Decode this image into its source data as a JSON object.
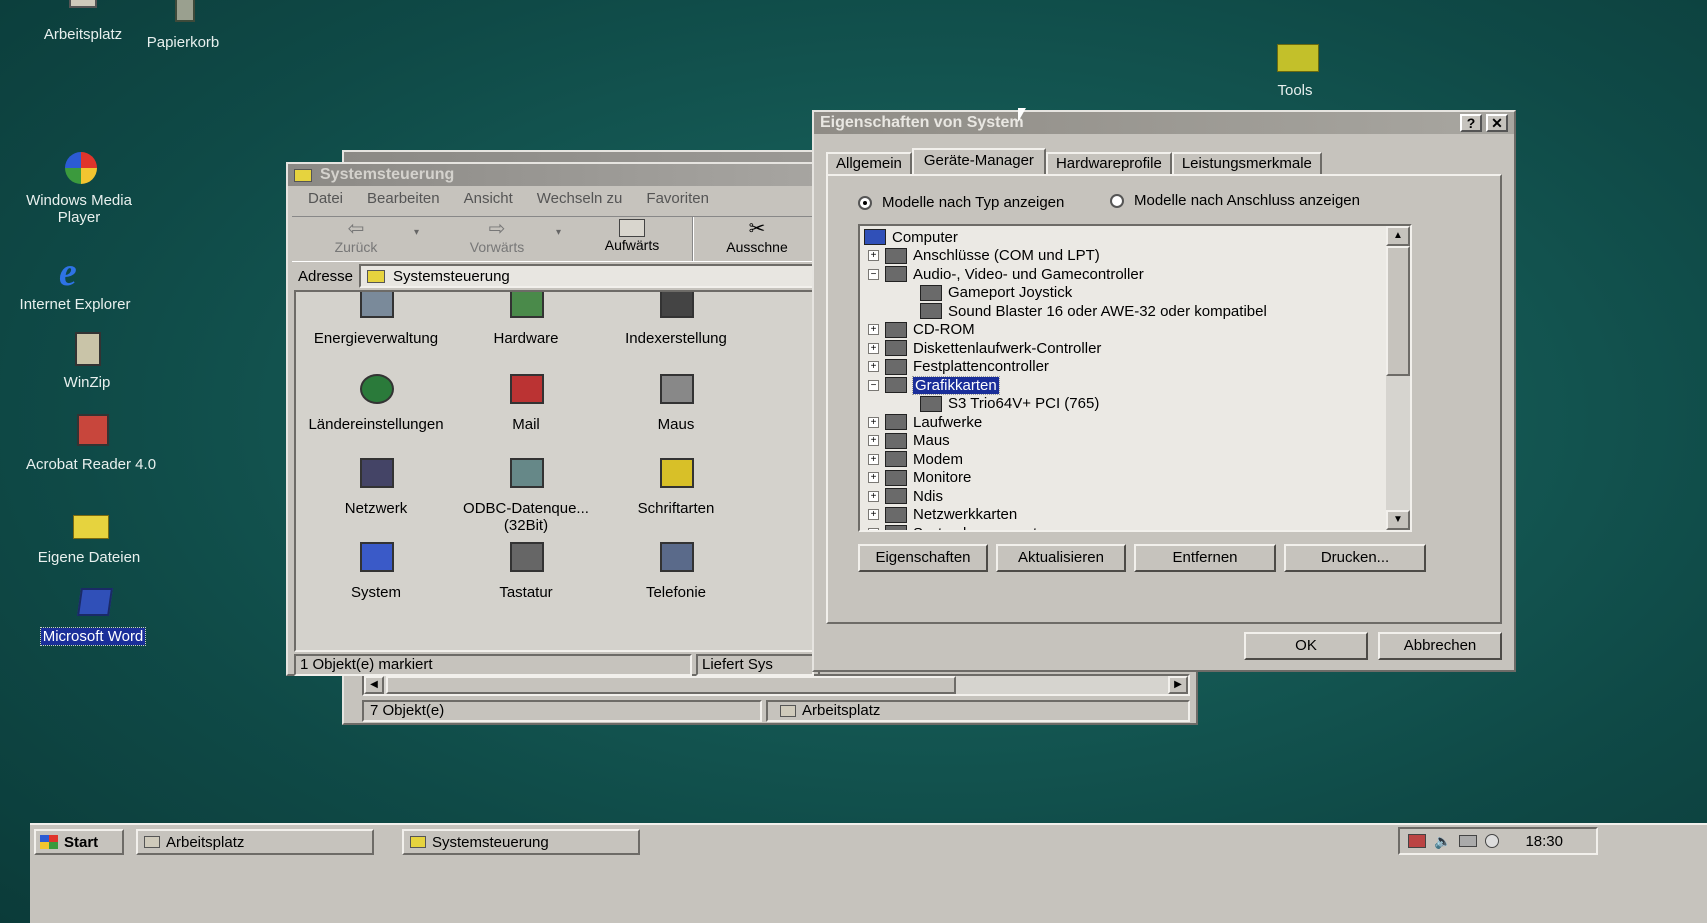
{
  "desktop": {
    "icons": [
      {
        "label": "Arbeitsplatz",
        "icon": "my-computer-icon"
      },
      {
        "label": "Papierkorb",
        "icon": "recycle-bin-icon"
      },
      {
        "label": "Windows Media Player",
        "icon": "media-player-icon"
      },
      {
        "label": "Internet Explorer",
        "icon": "internet-explorer-icon"
      },
      {
        "label": "WinZip",
        "icon": "winzip-icon"
      },
      {
        "label": "Acrobat Reader 4.0",
        "icon": "acrobat-icon"
      },
      {
        "label": "Eigene Dateien",
        "icon": "folder-icon"
      },
      {
        "label": "Microsoft Word",
        "icon": "word-icon"
      },
      {
        "label": "Tools",
        "icon": "folder-icon"
      }
    ]
  },
  "explorer_back": {
    "status_left": "7 Objekt(e)",
    "status_right": "Arbeitsplatz"
  },
  "control_panel": {
    "title": "Systemsteuerung",
    "menu": [
      "Datei",
      "Bearbeiten",
      "Ansicht",
      "Wechseln zu",
      "Favoriten"
    ],
    "toolbar": {
      "back": "Zurück",
      "forward": "Vorwärts",
      "up": "Aufwärts",
      "cut": "Ausschne"
    },
    "address_label": "Adresse",
    "address_value": "Systemsteuerung",
    "items": [
      {
        "label": "Energieverwaltung",
        "icon": "power-management-icon"
      },
      {
        "label": "Hardware",
        "icon": "hardware-icon"
      },
      {
        "label": "Indexerstellung",
        "icon": "indexing-binoculars-icon"
      },
      {
        "label": "Ländereinstellungen",
        "icon": "globe-icon"
      },
      {
        "label": "Mail",
        "icon": "mail-icon"
      },
      {
        "label": "Maus",
        "icon": "mouse-icon"
      },
      {
        "label": "Netzwerk",
        "icon": "network-icon"
      },
      {
        "label": "ODBC-Datenque... (32Bit)",
        "icon": "odbc-icon"
      },
      {
        "label": "Schriftarten",
        "icon": "fonts-folder-icon"
      },
      {
        "label": "System",
        "icon": "system-computer-icon"
      },
      {
        "label": "Tastatur",
        "icon": "keyboard-icon"
      },
      {
        "label": "Telefonie",
        "icon": "telephony-icon"
      }
    ],
    "status_left": "1 Objekt(e) markiert",
    "status_right": "Liefert Sys"
  },
  "system_dialog": {
    "title": "Eigenschaften von System",
    "tabs": [
      "Allgemein",
      "Geräte-Manager",
      "Hardwareprofile",
      "Leistungsmerkmale"
    ],
    "radio_type": "Modelle nach Typ anzeigen",
    "radio_connection": "Modelle nach Anschluss anzeigen",
    "tree": [
      {
        "label": "Computer",
        "level": 0,
        "expander": "",
        "icon": "computer-icon"
      },
      {
        "label": "Anschlüsse (COM und LPT)",
        "level": 1,
        "expander": "+",
        "icon": "port-icon"
      },
      {
        "label": "Audio-, Video- und Gamecontroller",
        "level": 1,
        "expander": "-",
        "icon": "audio-icon"
      },
      {
        "label": "Gameport Joystick",
        "level": 2,
        "expander": "",
        "icon": "joystick-icon"
      },
      {
        "label": "Sound Blaster 16 oder AWE-32 oder kompatibel",
        "level": 2,
        "expander": "",
        "icon": "sound-card-icon"
      },
      {
        "label": "CD-ROM",
        "level": 1,
        "expander": "+",
        "icon": "cdrom-icon"
      },
      {
        "label": "Diskettenlaufwerk-Controller",
        "level": 1,
        "expander": "+",
        "icon": "floppy-controller-icon"
      },
      {
        "label": "Festplattencontroller",
        "level": 1,
        "expander": "+",
        "icon": "disk-controller-icon"
      },
      {
        "label": "Grafikkarten",
        "level": 1,
        "expander": "-",
        "icon": "display-adapter-icon",
        "selected": true
      },
      {
        "label": "S3 Trio64V+ PCI (765)",
        "level": 2,
        "expander": "",
        "icon": "display-adapter-icon"
      },
      {
        "label": "Laufwerke",
        "level": 1,
        "expander": "+",
        "icon": "drive-icon"
      },
      {
        "label": "Maus",
        "level": 1,
        "expander": "+",
        "icon": "mouse-icon"
      },
      {
        "label": "Modem",
        "level": 1,
        "expander": "+",
        "icon": "modem-icon"
      },
      {
        "label": "Monitore",
        "level": 1,
        "expander": "+",
        "icon": "monitor-icon"
      },
      {
        "label": "Ndis",
        "level": 1,
        "expander": "+",
        "icon": "ndis-icon"
      },
      {
        "label": "Netzwerkkarten",
        "level": 1,
        "expander": "+",
        "icon": "network-card-icon"
      },
      {
        "label": "Systemkomponenten",
        "level": 1,
        "expander": "+",
        "icon": "system-components-icon"
      }
    ],
    "buttons": {
      "properties": "Eigenschaften",
      "refresh": "Aktualisieren",
      "remove": "Entfernen",
      "print": "Drucken..."
    },
    "ok": "OK",
    "cancel": "Abbrechen"
  },
  "taskbar": {
    "start": "Start",
    "tasks": [
      "Arbeitsplatz",
      "Systemsteuerung"
    ],
    "clock": "18:30"
  }
}
